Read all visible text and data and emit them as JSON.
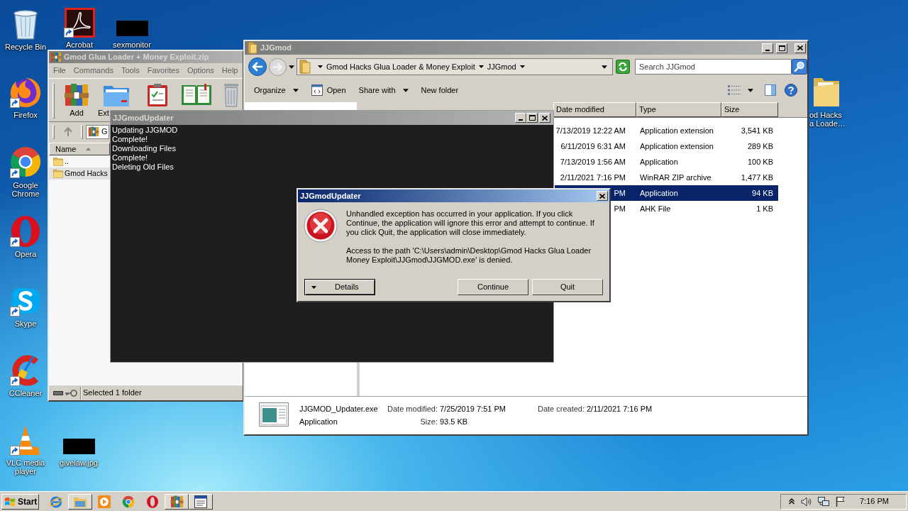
{
  "desktop_icons": [
    {
      "label": "Recycle Bin",
      "kind": "recycle_bin",
      "shortcut": false
    },
    {
      "label": "Acrobat",
      "kind": "acrobat",
      "shortcut": true
    },
    {
      "label": "sexmonitor",
      "kind": "thumbnail",
      "shortcut": false
    },
    {
      "label": "Firefox",
      "kind": "firefox",
      "shortcut": true
    },
    {
      "label": "Google Chrome",
      "kind": "chrome",
      "shortcut": true
    },
    {
      "label": "Opera",
      "kind": "opera",
      "shortcut": true
    },
    {
      "label": "Skype",
      "kind": "skype",
      "shortcut": true
    },
    {
      "label": "CCleaner",
      "kind": "ccleaner",
      "shortcut": true
    },
    {
      "label": "VLC media player",
      "kind": "vlc",
      "shortcut": true
    },
    {
      "label": "givelaw.jpg",
      "kind": "thumbnail",
      "shortcut": false
    },
    {
      "label": "od Hacks a Loade…",
      "kind": "folder",
      "shortcut": false
    }
  ],
  "archive_window": {
    "title": "Gmod Glua Loader + Money Exploit.zip",
    "menu": [
      "File",
      "Commands",
      "Tools",
      "Favorites",
      "Options",
      "Help"
    ],
    "toolbar": [
      {
        "label": "Add",
        "kind": "add"
      },
      {
        "label": "Ext",
        "kind": "extract"
      },
      {
        "kind": "test"
      },
      {
        "kind": "view"
      },
      {
        "kind": "delete"
      }
    ],
    "path": "G",
    "column": {
      "label": "Name",
      "sorted": true
    },
    "rows": [
      {
        "name": "..",
        "selected": false
      },
      {
        "name": "Gmod Hacks",
        "selected": true
      }
    ],
    "status": "Selected 1 folder"
  },
  "explorer_window": {
    "title": "JJGmod",
    "breadcrumb": [
      "Gmod Hacks Glua Loader & Money Exploit",
      "JJGmod"
    ],
    "search": {
      "placeholder": "Search JJGmod"
    },
    "toolbar": [
      {
        "label": "Organize",
        "kind": "menu"
      },
      {
        "label": "Open",
        "kind": "icon"
      },
      {
        "label": "Share with",
        "kind": "menu"
      },
      {
        "label": "New folder",
        "kind": "plain"
      }
    ],
    "columns": [
      "Date modified",
      "Type",
      "Size"
    ],
    "rows": [
      {
        "date": "7/13/2019 12:22 AM",
        "type": "Application extension",
        "size": "3,541 KB",
        "selected": false
      },
      {
        "date": "6/11/2019 6:31 AM",
        "type": "Application extension",
        "size": "289 KB",
        "selected": false
      },
      {
        "date": "7/13/2019 1:56 AM",
        "type": "Application",
        "size": "100 KB",
        "selected": false
      },
      {
        "date": "2/11/2021 7:16 PM",
        "type": "WinRAR ZIP archive",
        "size": "1,477 KB",
        "selected": false
      },
      {
        "date": "PM",
        "type": "Application",
        "size": "94 KB",
        "selected": true
      },
      {
        "date": "PM",
        "type": "AHK File",
        "size": "1 KB",
        "selected": false
      }
    ],
    "details": {
      "name": "JJGMOD_Updater.exe",
      "type": "Application",
      "fields": [
        {
          "label": "Date modified:",
          "value": "7/25/2019 7:51 PM"
        },
        {
          "label": "Size:",
          "value": "93.5 KB"
        },
        {
          "label": "Date created:",
          "value": "2/11/2021 7:16 PM"
        }
      ]
    }
  },
  "console_window": {
    "title": "JJGmodUpdater",
    "lines": [
      "Updating JJGMOD",
      "Complete!",
      "Downloading Files",
      "Complete!",
      "Deleting Old Files"
    ]
  },
  "error_dialog": {
    "title": "JJGmodUpdater",
    "message": "Unhandled exception has occurred in your application. If you click Continue, the application will ignore this error and attempt to continue. If you click Quit, the application will close immediately.",
    "detail": "Access to the path 'C:\\Users\\admin\\Desktop\\Gmod Hacks Glua Loader Money Exploit\\JJGmod\\JJGMOD.exe' is denied.",
    "buttons": [
      {
        "label": "Details",
        "kind": "expander",
        "focused": true
      },
      {
        "label": "Continue",
        "kind": "plain",
        "focused": false
      },
      {
        "label": "Quit",
        "kind": "plain",
        "focused": false
      }
    ]
  },
  "taskbar": {
    "start": "Start",
    "apps": [
      {
        "kind": "ie",
        "open": false
      },
      {
        "kind": "explorer",
        "open": true
      },
      {
        "kind": "media",
        "open": false
      },
      {
        "kind": "chrome",
        "open": false
      },
      {
        "kind": "opera",
        "open": false
      },
      {
        "kind": "winrar",
        "open": true
      },
      {
        "kind": "app",
        "open": true
      }
    ],
    "clock": "7:16 PM"
  }
}
